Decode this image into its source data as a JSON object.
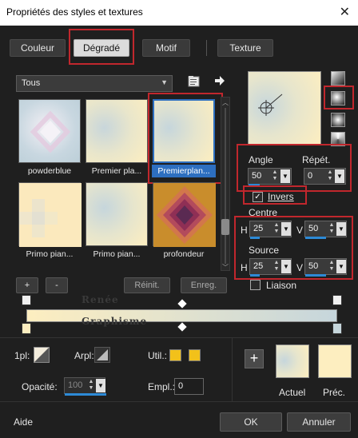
{
  "window": {
    "title": "Propriétés des styles et textures",
    "close": "✕"
  },
  "tabs": [
    {
      "label": "Couleur"
    },
    {
      "label": "Dégradé"
    },
    {
      "label": "Motif"
    },
    {
      "label": "Texture"
    }
  ],
  "library": {
    "select_value": "Tous",
    "items": [
      {
        "label": "powderblue"
      },
      {
        "label": "Premier pla..."
      },
      {
        "label": "Premierplan..."
      },
      {
        "label": "Primo pian..."
      },
      {
        "label": "Primo pian..."
      },
      {
        "label": "profondeur"
      }
    ],
    "add": "+",
    "remove": "-",
    "reset": "Réinit.",
    "save": "Enreg."
  },
  "controls": {
    "angle_label": "Angle",
    "angle_value": "50",
    "repeat_label": "Répét.",
    "repeat_value": "0",
    "invert_label": "Invers",
    "center_label": "Centre",
    "center_h_label": "H",
    "center_h": "25",
    "center_v_label": "V",
    "center_v": "50",
    "source_label": "Source",
    "source_h_label": "H",
    "source_h": "25",
    "source_v_label": "V",
    "source_v": "50",
    "link_label": "Liaison"
  },
  "watermark": {
    "line1": "Renée",
    "line2": "Graphisme"
  },
  "bottom": {
    "fg_label": "1pl:",
    "bg_label": "Arpl:",
    "user_label": "Util.:",
    "opacity_label": "Opacité:",
    "opacity_value": "100",
    "location_label": "Empl.:",
    "location_value": "0",
    "current_label": "Actuel",
    "previous_label": "Préc."
  },
  "footer": {
    "help": "Aide",
    "ok": "OK",
    "cancel": "Annuler"
  },
  "colors": {
    "accent_red": "#c1272d",
    "selection_blue": "#2d6fc0",
    "gradient_start": "#fdeec0",
    "gradient_end": "#c6d6dc",
    "user_swatch": "#f2c11a"
  }
}
